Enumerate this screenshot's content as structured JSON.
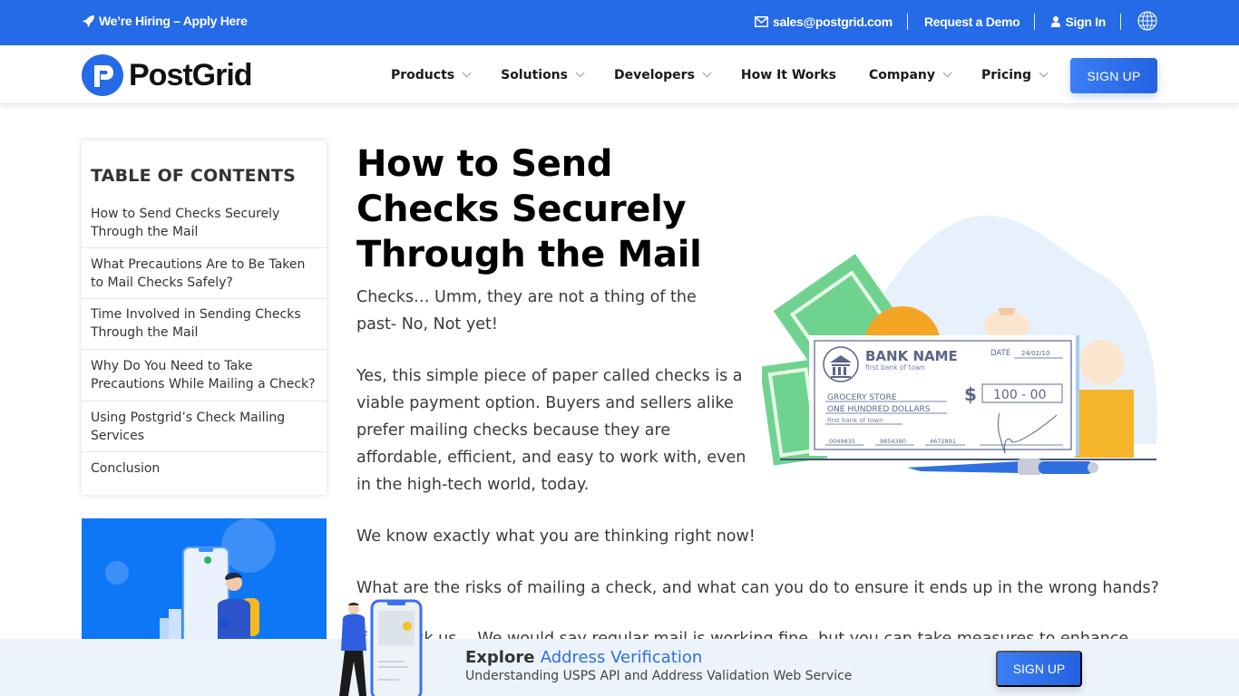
{
  "topbar": {
    "hiring_label": "We’re Hiring – Apply Here",
    "email": "sales@postgrid.com",
    "request_demo": "Request a Demo",
    "sign_in": "Sign In",
    "icons": {
      "hiring": "rocket-icon",
      "email": "envelope-icon",
      "sign_in": "user-icon",
      "language": "globe-icon"
    }
  },
  "nav": {
    "brand": "PostGrid",
    "items": [
      {
        "label": "Products",
        "dropdown": true
      },
      {
        "label": "Solutions",
        "dropdown": true
      },
      {
        "label": "Developers",
        "dropdown": true
      },
      {
        "label": "How It Works",
        "dropdown": false
      },
      {
        "label": "Company",
        "dropdown": true
      },
      {
        "label": "Pricing",
        "dropdown": true
      }
    ],
    "signup_label": "SIGN UP"
  },
  "toc": {
    "heading": "TABLE OF CONTENTS",
    "items": [
      "How to Send Checks Securely Through the Mail",
      "What Precautions Are to Be Taken to Mail Checks Safely?",
      "Time Involved in Sending Checks Through the Mail",
      "Why Do You Need to Take Precautions While Mailing a Check?",
      "Using Postgrid’s Check Mailing Services",
      "Conclusion"
    ]
  },
  "article": {
    "title": "How to Send Checks Securely Through the Mail",
    "paragraphs": [
      "Checks… Umm, they are not a thing of the past- No, Not yet!",
      "Yes, this simple piece of paper called checks is a viable payment option. Buyers and sellers alike prefer mailing checks because they are affordable, efficient, and easy to work with, even in the high-tech world, today.",
      "We know exactly what you are thinking right now!",
      "What are the risks of mailing a check, and what can you do to ensure it ends up in the wrong hands?",
      "If you ask us… We would say regular mail is working fine, but you can take measures to enhance"
    ]
  },
  "illustration": {
    "bank_name": "BANK NAME",
    "bank_sub": "first bank of town",
    "date_label": "DATE",
    "date_value": "24/02/10",
    "payee": "GROCERY STORE",
    "amount_words": "ONE HUNDRED DOLLARS",
    "memo": "first bank of town",
    "currency": "$",
    "amount": "100 - 00",
    "numbers": [
      "0049835",
      "9854380",
      "4672891"
    ]
  },
  "banner": {
    "explore": "Explore",
    "highlight": "Address Verification",
    "subtitle": "Understanding USPS API and Address Validation Web Service",
    "signup_label": "SIGN UP"
  },
  "colors": {
    "brand_blue": "#256ae6",
    "banner_bg": "#edf3fb",
    "highlight": "#2f6fdf"
  }
}
